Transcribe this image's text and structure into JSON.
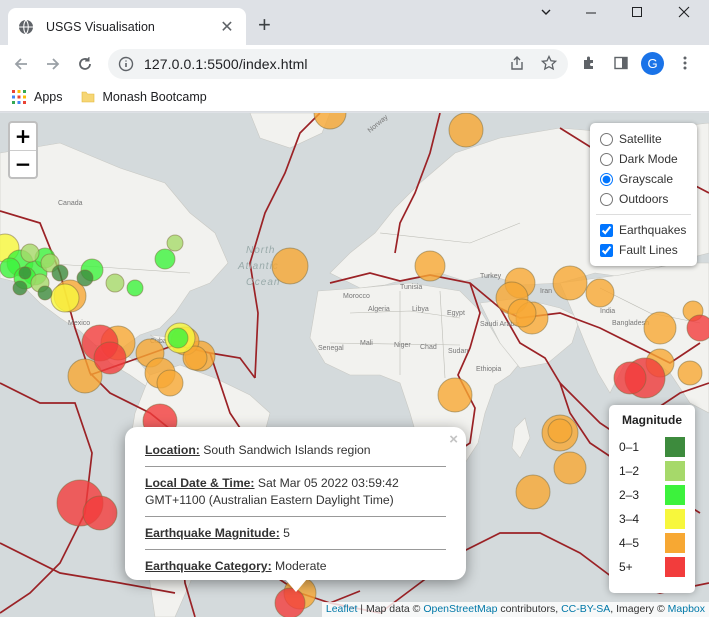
{
  "browser": {
    "tab_title": "USGS Visualisation",
    "tab_close": "✕",
    "new_tab": "+",
    "url": "127.0.0.1:5500/index.html",
    "avatar_letter": "G",
    "bookmarks": {
      "apps": "Apps",
      "folder": "Monash Bootcamp"
    }
  },
  "map": {
    "zoom_in": "+",
    "zoom_out": "−",
    "base_layers": [
      {
        "label": "Satellite",
        "checked": false
      },
      {
        "label": "Dark Mode",
        "checked": false
      },
      {
        "label": "Grayscale",
        "checked": true
      },
      {
        "label": "Outdoors",
        "checked": false
      }
    ],
    "overlays": [
      {
        "label": "Earthquakes",
        "checked": true
      },
      {
        "label": "Fault Lines",
        "checked": true
      }
    ],
    "labels": {
      "north_atlantic": [
        "North",
        "Atlantic",
        "Ocean"
      ],
      "canada": "Canada",
      "mexico": "Mexico",
      "morocco": "Morocco",
      "algeria": "Algeria",
      "libya": "Libya",
      "egypt": "Egypt",
      "saudi": "Saudi Arabia",
      "senegal": "Senegal",
      "mali": "Mali",
      "niger": "Niger",
      "chad": "Chad",
      "sudan": "Sudan",
      "tunisia": "Tunisia",
      "turkey": "Turkey",
      "iran": "Iran",
      "india": "India",
      "bangladesh": "Bangladesh",
      "norway": "Norway",
      "cuba": "Cuba",
      "ethiopia": "Ethiopia"
    }
  },
  "legend": {
    "title": "Magnitude",
    "items": [
      {
        "label": "0–1",
        "color": "#3d8b3d"
      },
      {
        "label": "1–2",
        "color": "#a6d96a"
      },
      {
        "label": "2–3",
        "color": "#3cf23c"
      },
      {
        "label": "3–4",
        "color": "#f7f73c"
      },
      {
        "label": "4–5",
        "color": "#f7a833"
      },
      {
        "label": "5+",
        "color": "#f23c3c"
      }
    ]
  },
  "popup": {
    "close": "×",
    "location_label": "Location:",
    "location_value": "South Sandwich Islands region",
    "datetime_label": "Local Date & Time:",
    "datetime_value": "Sat Mar 05 2022 03:59:42 GMT+1100 (Australian Eastern Daylight Time)",
    "magnitude_label": "Earthquake Magnitude:",
    "magnitude_value": "5",
    "category_label": "Earthquake Category:",
    "category_value": "Moderate"
  },
  "attribution": {
    "leaflet": "Leaflet",
    "sep": " | Map data © ",
    "osm": "OpenStreetMap",
    "contrib": " contributors, ",
    "license": "CC-BY-SA",
    "imagery": ", Imagery © ",
    "mapbox": "Mapbox"
  }
}
